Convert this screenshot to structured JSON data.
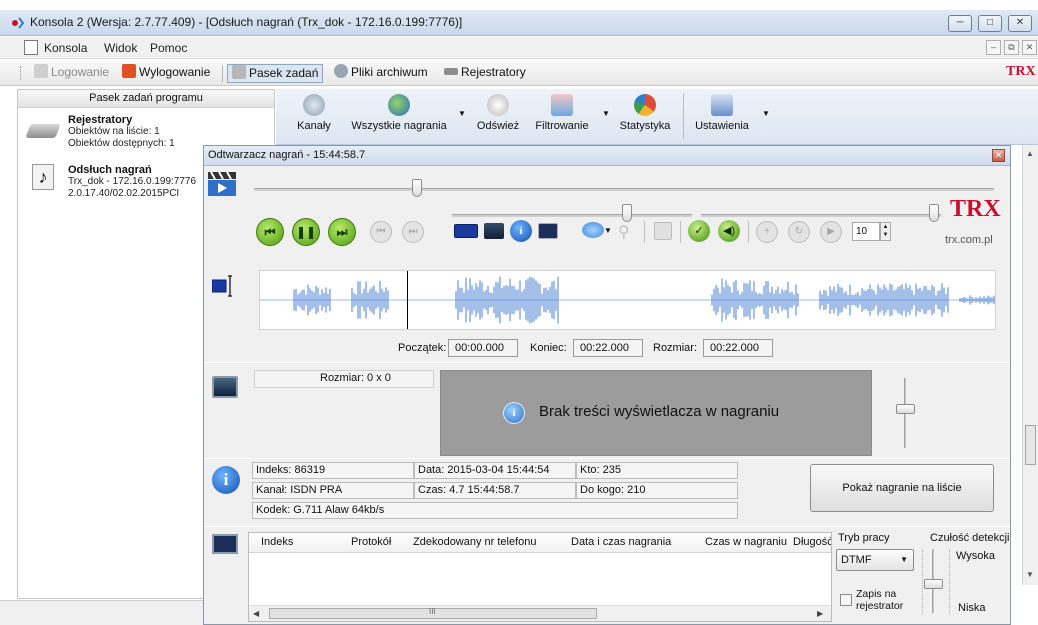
{
  "window": {
    "title": "Konsola 2 (Wersja: 2.7.77.409) - [Odsłuch nagrań (Trx_dok - 172.16.0.199:7776)]",
    "min": "─",
    "max": "□",
    "close": "✕"
  },
  "menu": {
    "items": [
      "Konsola",
      "Widok",
      "Pomoc"
    ],
    "mdi_min": "–",
    "mdi_restore": "⧉",
    "mdi_close": "✕"
  },
  "toolbar": {
    "items": [
      "Logowanie",
      "Wylogowanie",
      "Pasek zadań",
      "Pliki archiwum",
      "Rejestratory"
    ],
    "logo": "TRX"
  },
  "left_panel": {
    "header": "Pasek zadań programu",
    "entries": [
      {
        "title": "Rejestratory",
        "lines": [
          "Obiektów na liście: 1",
          "Obiektów dostępnych: 1"
        ],
        "icon": "recorder-icon"
      },
      {
        "title": "Odsłuch nagrań",
        "lines": [
          "Trx_dok - 172.16.0.199:7776",
          "2.0.17.40/02.02.2015PCI"
        ],
        "icon": "music-note-icon"
      }
    ]
  },
  "ribbon": {
    "buttons": [
      "Kanały",
      "Wszystkie nagrania",
      "Odśwież",
      "Filtrowanie",
      "Statystyka",
      "Ustawienia"
    ]
  },
  "player": {
    "title": "Odtwarzacz nagrań - 15:44:58.7",
    "close": "✕",
    "position_fraction": 0.22,
    "volume_fraction": 0.73,
    "balance_fraction": 0.97,
    "step_value": "10",
    "logo": "TRX",
    "site": "trx.com.pl",
    "waveform_cursor_fraction": 0.2,
    "range": {
      "start_label": "Początek:",
      "start": "00:00.000",
      "end_label": "Koniec:",
      "end": "00:22.000",
      "size_label": "Rozmiar:",
      "size": "00:22.000"
    },
    "display": {
      "size_label": "Rozmiar: 0 x 0",
      "message": "Brak treści wyświetlacza w nagraniu"
    },
    "info": {
      "index": "Indeks: 86319",
      "date": "Data: 2015-03-04 15:44:54",
      "who": "Kto: 235",
      "channel": "Kanał: ISDN PRA",
      "time": "Czas: 4.7 15:44:58.7",
      "to_whom": "Do kogo: 210",
      "codec": "Kodek: G.711 Alaw 64kb/s",
      "show_button": "Pokaż nagranie na liście"
    },
    "dtmf": {
      "columns": [
        "Indeks",
        "Protokół",
        "Zdekodowany nr telefonu",
        "Data i czas nagrania",
        "Czas w nagraniu",
        "Długość"
      ],
      "scroll_mark": "III",
      "mode_label": "Tryb pracy",
      "mode_value": "DTMF",
      "record_checkbox": "Zapis na rejestrator",
      "sensitivity_label": "Czułość detekcji",
      "high": "Wysoka",
      "low": "Niska",
      "sensitivity_fraction": 0.55
    }
  },
  "colors": {
    "accent": "#4f9d0e",
    "brand": "#c8102e",
    "titlebar": "#c9d9ec",
    "display_bg": "#9c9c9c"
  }
}
